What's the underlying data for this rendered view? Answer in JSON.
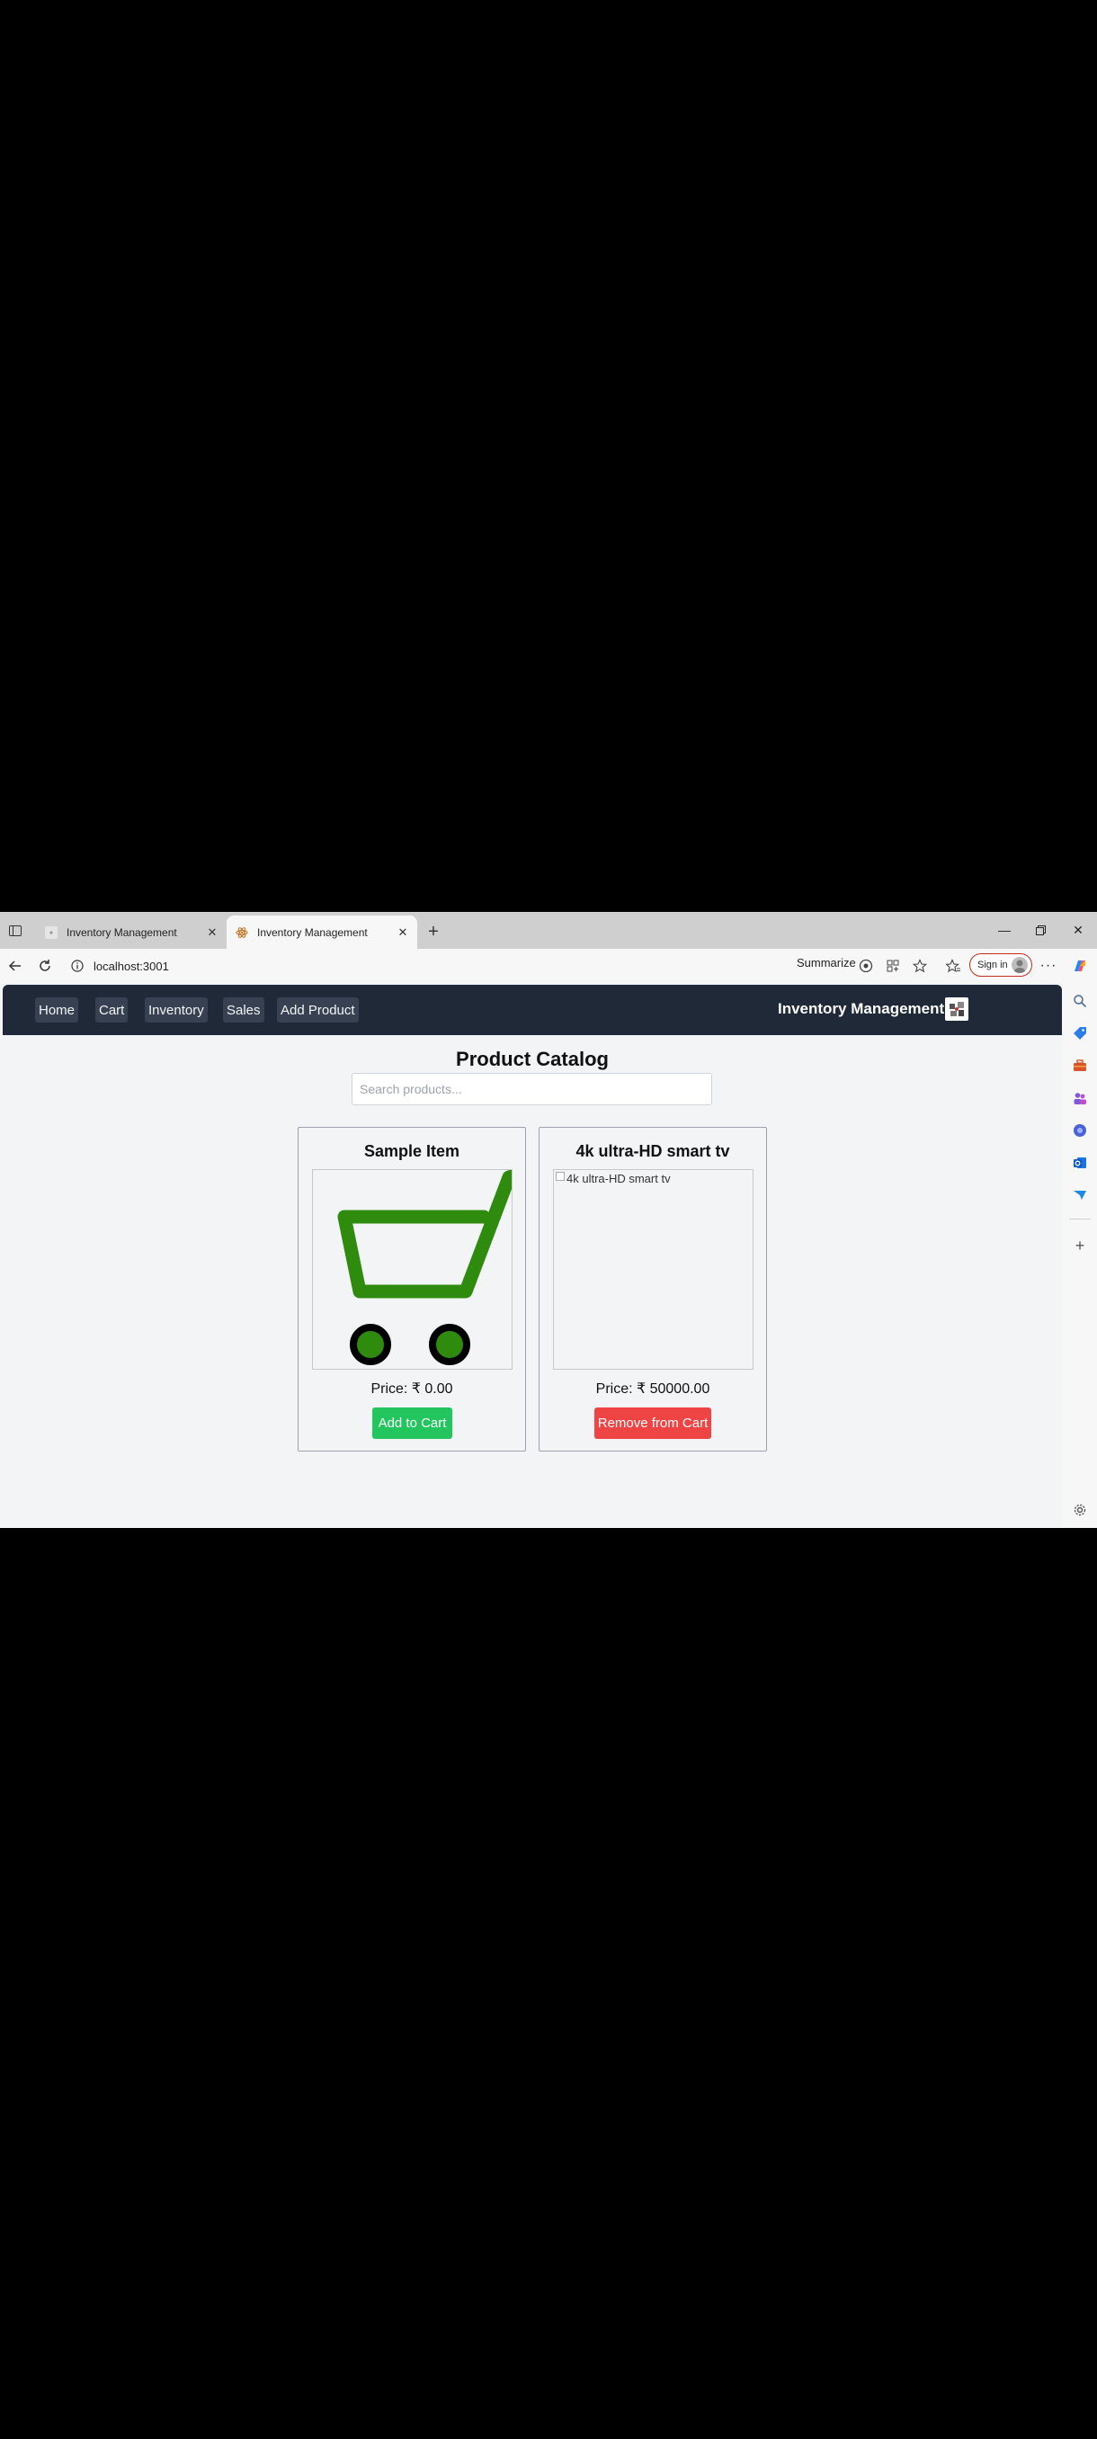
{
  "browser": {
    "tabs": [
      {
        "title": "Inventory Management",
        "active": false
      },
      {
        "title": "Inventory Management",
        "active": true
      }
    ],
    "address": "localhost:3001",
    "summarize_label": "Summarize",
    "signin_label": "Sign in"
  },
  "nav": {
    "items": [
      "Home",
      "Cart",
      "Inventory",
      "Sales",
      "Add Product"
    ],
    "brand": "Inventory Management"
  },
  "catalog": {
    "title": "Product Catalog",
    "search_placeholder": "Search products...",
    "products": [
      {
        "name": "Sample Item",
        "price": "Price: ₹ 0.00",
        "image_alt": "",
        "button": "Add to Cart",
        "button_color": "#22c55e"
      },
      {
        "name": "4k ultra-HD smart tv",
        "price": "Price: ₹ 50000.00",
        "image_alt": "4k ultra-HD smart tv",
        "button": "Remove from Cart",
        "button_color": "#ef4444"
      }
    ]
  },
  "colors": {
    "navbar": "#1f2937",
    "nav_item_bg": "#374151",
    "cart_green": "#2e8b0e",
    "add_button": "#22c55e",
    "remove_button": "#ef4444"
  }
}
